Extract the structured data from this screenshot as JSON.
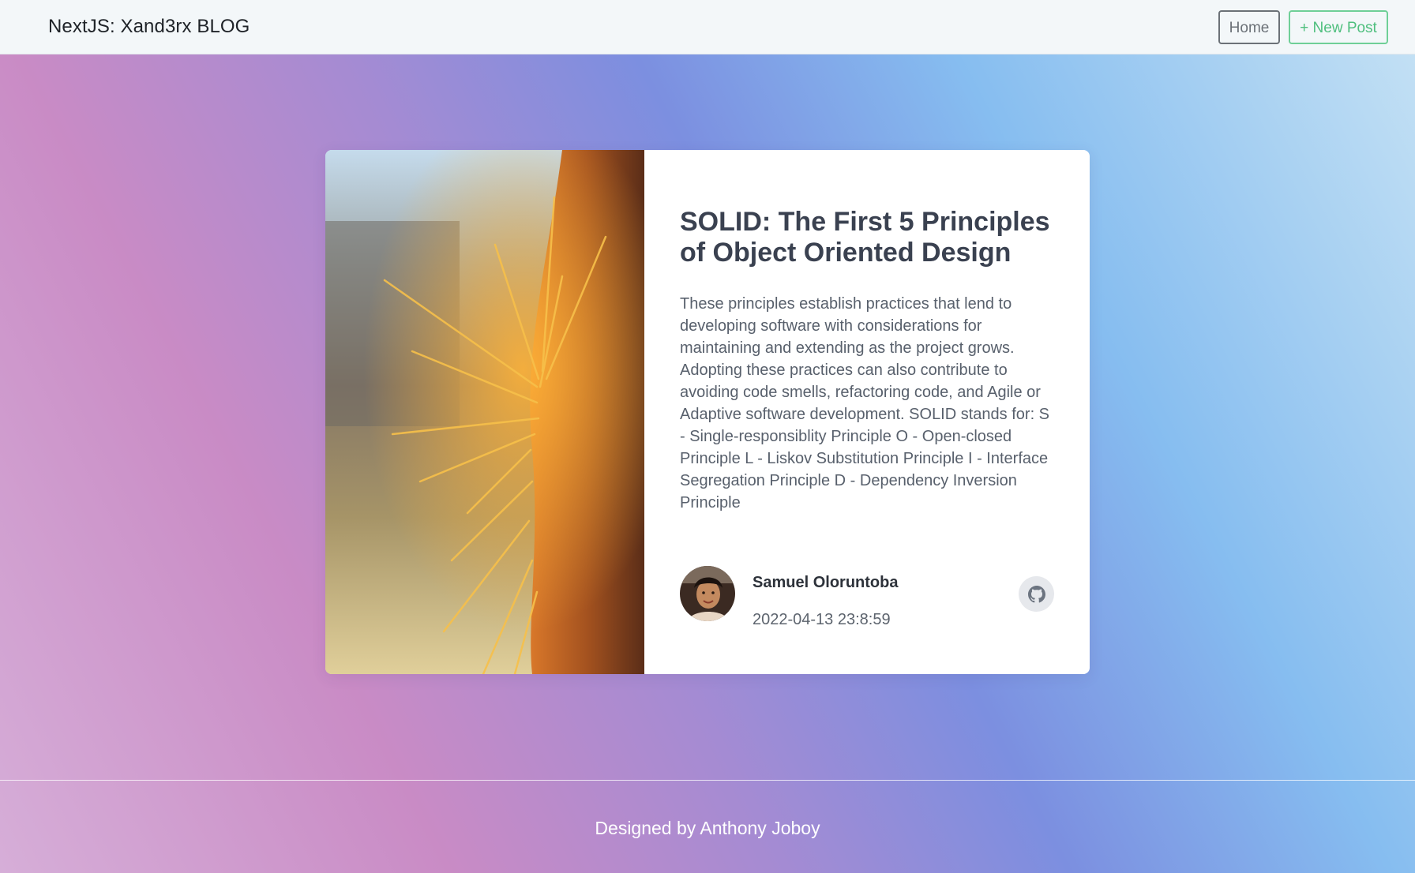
{
  "navbar": {
    "brand": "NextJS: Xand3rx BLOG",
    "home_label": "Home",
    "new_post_label": "+ New Post"
  },
  "post": {
    "title": "SOLID: The First 5 Principles of Object Oriented Design",
    "excerpt": "These principles establish practices that lend to developing software with considerations for maintaining and extending as the project grows. Adopting these practices can also contribute to avoiding code smells, refactoring code, and Agile or Adaptive software development. SOLID stands for: S - Single-responsiblity Principle O - Open-closed Principle L - Liskov Substitution Principle I - Interface Segregation Principle D - Dependency Inversion Principle",
    "image_icon": "cactus-photo",
    "author": {
      "name": "Samuel Oloruntoba",
      "date": "2022-04-13 23:8:59",
      "avatar_icon": "author-avatar",
      "link_icon": "github-icon"
    }
  },
  "footer": {
    "credit": "Designed by Anthony Joboy"
  },
  "colors": {
    "new_post_accent": "#4fbf7e",
    "title_text": "#3a4150",
    "card_bg": "#ffffff"
  }
}
